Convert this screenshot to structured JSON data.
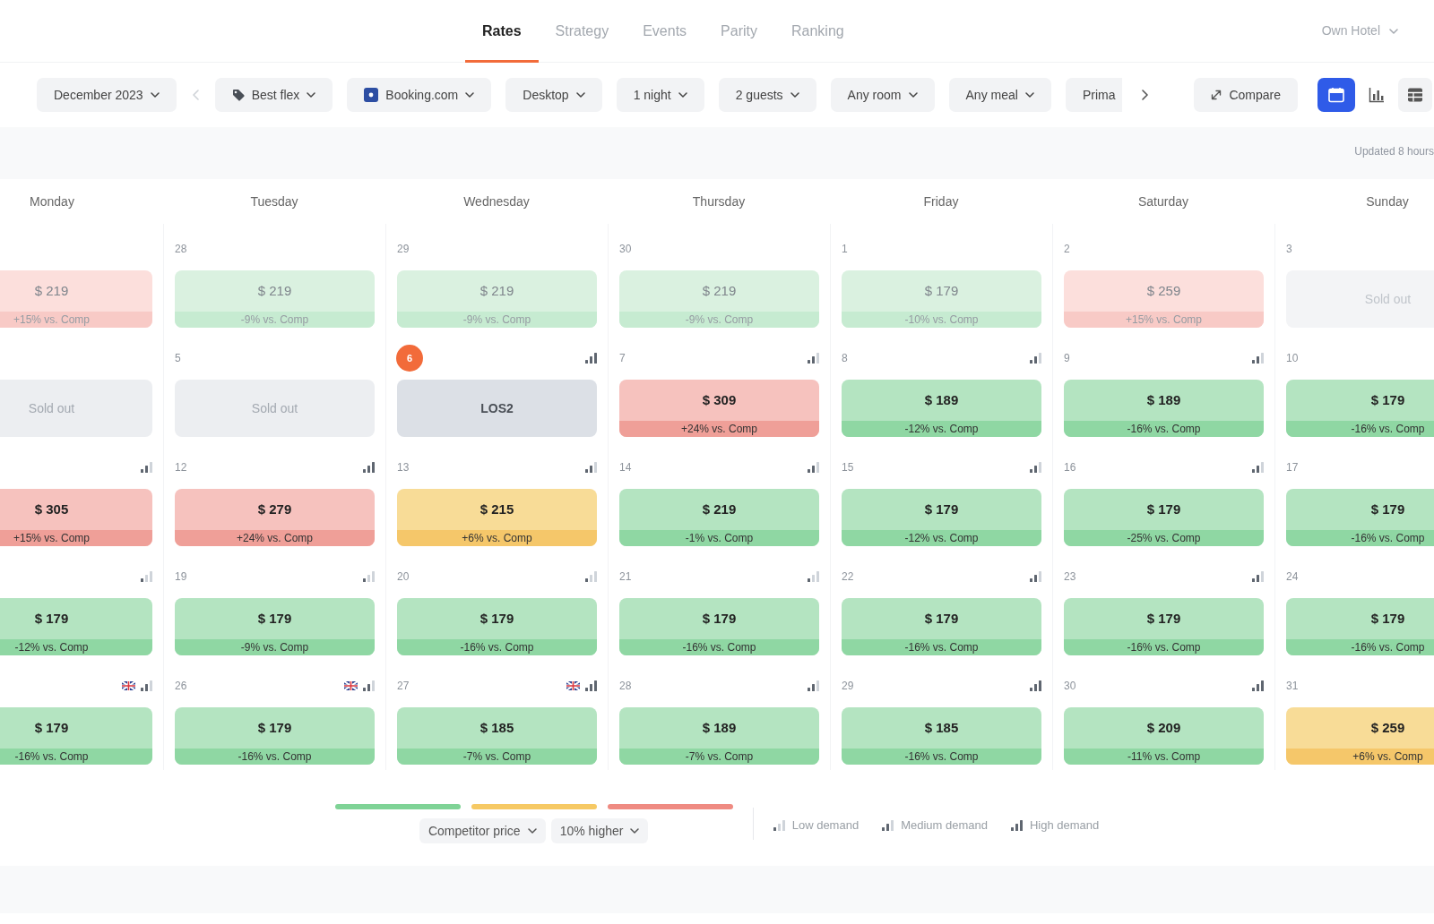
{
  "header": {
    "tabs": [
      {
        "label": "Rates",
        "selected": true
      },
      {
        "label": "Strategy",
        "selected": false
      },
      {
        "label": "Events",
        "selected": false
      },
      {
        "label": "Parity",
        "selected": false
      },
      {
        "label": "Ranking",
        "selected": false
      }
    ],
    "hotel": {
      "label": "Own Hotel",
      "disabled": true
    }
  },
  "toolbar": {
    "period": {
      "label": "December 2023"
    },
    "back_disabled": true,
    "forward_disabled": false,
    "filters": [
      {
        "kind": "tag",
        "label": "Best flex"
      },
      {
        "kind": "logo",
        "label": "Booking.com"
      },
      {
        "kind": "plain",
        "label": "Desktop"
      },
      {
        "kind": "plain",
        "label": "1 night"
      },
      {
        "kind": "plain",
        "label": "2 guests"
      },
      {
        "kind": "plain",
        "label": "Any room"
      },
      {
        "kind": "plain",
        "label": "Any meal"
      },
      {
        "kind": "cut",
        "label": "Prima"
      }
    ],
    "compare": {
      "label": "Compare"
    },
    "views": [
      {
        "kind": "calendar",
        "selected": true
      },
      {
        "kind": "chart",
        "selected": false
      },
      {
        "kind": "table",
        "selected": false
      }
    ]
  },
  "updated": "Updated 8 hours",
  "calendar": {
    "weekdays": [
      "Monday",
      "Tuesday",
      "Wednesday",
      "Thursday",
      "Friday",
      "Saturday",
      "Sunday"
    ],
    "weeks": [
      {
        "days": [
          {
            "kind": "above",
            "price": "$ 219",
            "comparison": "+15% vs. Comp",
            "past": true
          },
          {
            "day": "28",
            "kind": "below",
            "price": "$ 219",
            "comparison": "-9% vs. Comp",
            "past": true
          },
          {
            "day": "29",
            "kind": "below",
            "price": "$ 219",
            "comparison": "-9% vs. Comp",
            "past": true
          },
          {
            "day": "30",
            "kind": "below",
            "price": "$ 219",
            "comparison": "-9% vs. Comp",
            "past": true
          },
          {
            "day": "1",
            "kind": "below",
            "price": "$ 179",
            "comparison": "-10% vs. Comp",
            "past": true
          },
          {
            "day": "2",
            "kind": "above",
            "price": "$ 259",
            "comparison": "+15% vs. Comp",
            "past": true
          },
          {
            "day": "3",
            "kind": "sold_out",
            "label": "Sold out",
            "past": true
          }
        ]
      },
      {
        "days": [
          {
            "kind": "sold_out",
            "label": "Sold out"
          },
          {
            "day": "5",
            "kind": "sold_out",
            "label": "Sold out"
          },
          {
            "day": "6",
            "kind": "restricted",
            "label": "LOS2",
            "today": true,
            "demand": {
              "kind": "high"
            }
          },
          {
            "day": "7",
            "kind": "above",
            "price": "$ 309",
            "comparison": "+24% vs. Comp",
            "demand": {
              "kind": "medium"
            }
          },
          {
            "day": "8",
            "kind": "below",
            "price": "$ 189",
            "comparison": "-12% vs. Comp",
            "demand": {
              "kind": "medium"
            }
          },
          {
            "day": "9",
            "kind": "below",
            "price": "$ 189",
            "comparison": "-16% vs. Comp",
            "demand": {
              "kind": "medium"
            }
          },
          {
            "day": "10",
            "kind": "below",
            "price": "$ 179",
            "comparison": "-16% vs. Comp"
          }
        ]
      },
      {
        "days": [
          {
            "kind": "above",
            "price": "$ 305",
            "comparison": "+15% vs. Comp",
            "demand": {
              "kind": "medium"
            }
          },
          {
            "day": "12",
            "kind": "above",
            "price": "$ 279",
            "comparison": "+24% vs. Comp",
            "demand": {
              "kind": "high"
            }
          },
          {
            "day": "13",
            "kind": "near",
            "price": "$ 215",
            "comparison": "+6% vs. Comp",
            "demand": {
              "kind": "medium"
            }
          },
          {
            "day": "14",
            "kind": "below",
            "price": "$ 219",
            "comparison": "-1% vs. Comp",
            "demand": {
              "kind": "medium"
            }
          },
          {
            "day": "15",
            "kind": "below",
            "price": "$ 179",
            "comparison": "-12% vs. Comp",
            "demand": {
              "kind": "medium"
            }
          },
          {
            "day": "16",
            "kind": "below",
            "price": "$ 179",
            "comparison": "-25% vs. Comp",
            "demand": {
              "kind": "medium"
            }
          },
          {
            "day": "17",
            "kind": "below",
            "price": "$ 179",
            "comparison": "-16% vs. Comp"
          }
        ]
      },
      {
        "days": [
          {
            "kind": "below",
            "price": "$ 179",
            "comparison": "-12% vs. Comp",
            "demand": {
              "kind": "low"
            }
          },
          {
            "day": "19",
            "kind": "below",
            "price": "$ 179",
            "comparison": "-9% vs. Comp",
            "demand": {
              "kind": "low"
            }
          },
          {
            "day": "20",
            "kind": "below",
            "price": "$ 179",
            "comparison": "-16% vs. Comp",
            "demand": {
              "kind": "low"
            }
          },
          {
            "day": "21",
            "kind": "below",
            "price": "$ 179",
            "comparison": "-16% vs. Comp",
            "demand": {
              "kind": "low"
            }
          },
          {
            "day": "22",
            "kind": "below",
            "price": "$ 179",
            "comparison": "-16% vs. Comp",
            "demand": {
              "kind": "medium"
            }
          },
          {
            "day": "23",
            "kind": "below",
            "price": "$ 179",
            "comparison": "-16% vs. Comp",
            "demand": {
              "kind": "medium"
            }
          },
          {
            "day": "24",
            "kind": "below",
            "price": "$ 179",
            "comparison": "-16% vs. Comp"
          }
        ]
      },
      {
        "days": [
          {
            "kind": "below",
            "price": "$ 179",
            "comparison": "-16% vs. Comp",
            "event": true,
            "demand": {
              "kind": "medium"
            }
          },
          {
            "day": "26",
            "kind": "below",
            "price": "$ 179",
            "comparison": "-16% vs. Comp",
            "event": true,
            "demand": {
              "kind": "medium"
            }
          },
          {
            "day": "27",
            "kind": "below",
            "price": "$ 185",
            "comparison": "-7% vs. Comp",
            "event": true,
            "demand": {
              "kind": "high"
            }
          },
          {
            "day": "28",
            "kind": "below",
            "price": "$ 189",
            "comparison": "-7% vs. Comp",
            "demand": {
              "kind": "medium"
            }
          },
          {
            "day": "29",
            "kind": "below",
            "price": "$ 185",
            "comparison": "-16% vs. Comp",
            "demand": {
              "kind": "high"
            }
          },
          {
            "day": "30",
            "kind": "below",
            "price": "$ 209",
            "comparison": "-11% vs. Comp",
            "demand": {
              "kind": "high"
            }
          },
          {
            "day": "31",
            "kind": "near",
            "price": "$ 259",
            "comparison": "+6% vs. Comp"
          }
        ]
      }
    ]
  },
  "legend": {
    "scale": [
      {
        "color": "#7fd396"
      },
      {
        "color": "#f6c964"
      },
      {
        "color": "#ef8b82"
      }
    ],
    "metric": "Competitor price",
    "threshold": "10% higher",
    "demand": [
      {
        "kind": "low",
        "label": "Low demand"
      },
      {
        "kind": "medium",
        "label": "Medium demand"
      },
      {
        "kind": "high",
        "label": "High demand"
      }
    ]
  }
}
